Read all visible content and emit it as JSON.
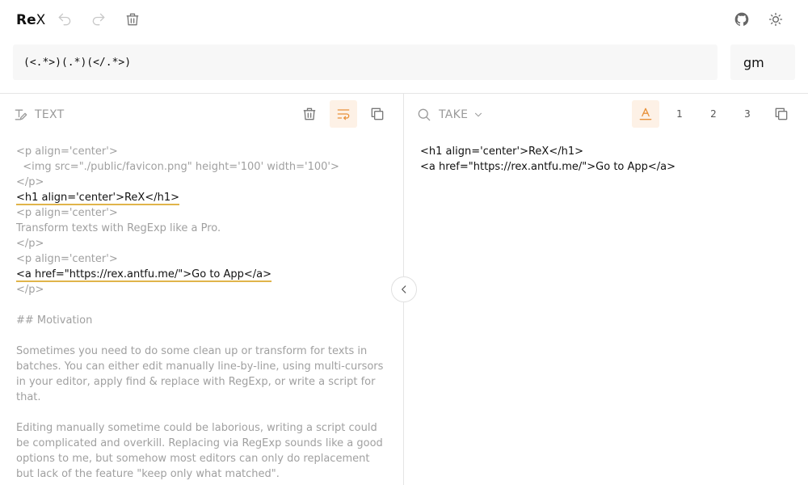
{
  "app": {
    "logo_bold": "Re",
    "logo_light": "X"
  },
  "regex": {
    "pattern": "(<.*>)(.*)(</.*>)",
    "flags": "gm"
  },
  "left_pane": {
    "label": "TEXT",
    "lines": [
      {
        "text": "<p align='center'>",
        "match": false
      },
      {
        "text": "  <img src=\"./public/favicon.png\" height='100' width='100'>",
        "match": false
      },
      {
        "text": "</p>",
        "match": false
      },
      {
        "text": "<h1 align='center'>ReX</h1>",
        "match": true
      },
      {
        "text": "<p align='center'>",
        "match": false
      },
      {
        "text": "Transform texts with RegExp like a Pro.",
        "match": false
      },
      {
        "text": "</p>",
        "match": false
      },
      {
        "text": "<p align='center'>",
        "match": false
      },
      {
        "text": "<a href=\"https://rex.antfu.me/\">Go to App</a>",
        "match": true
      },
      {
        "text": "</p>",
        "match": false
      },
      {
        "text": "",
        "match": false
      },
      {
        "text": "## Motivation",
        "match": false
      },
      {
        "text": "",
        "match": false
      },
      {
        "text": "Sometimes you need to do some clean up or transform for texts in",
        "match": false
      },
      {
        "text": "batches. You can either edit manually line-by-line, using multi-cursors",
        "match": false
      },
      {
        "text": "in your editor, apply find & replace with RegExp, or write a script for",
        "match": false
      },
      {
        "text": "that.",
        "match": false
      },
      {
        "text": "",
        "match": false
      },
      {
        "text": "Editing manually sometime could be laborious, writing a script could",
        "match": false
      },
      {
        "text": "be complicated and overkill. Replacing via RegExp sounds like a good",
        "match": false
      },
      {
        "text": "options to me, but somehow most editors can only do replacement",
        "match": false
      },
      {
        "text": "but lack of the feature \"keep only what matched\".",
        "match": false
      }
    ]
  },
  "right_pane": {
    "label": "TAKE",
    "group_buttons": [
      "1",
      "2",
      "3"
    ],
    "result_lines": [
      "<h1 align='center'>ReX</h1>",
      "<a href=\"https://rex.antfu.me/\">Go to App</a>"
    ]
  },
  "colors": {
    "accent": "#e8913a",
    "match_underline": "#e0b44a",
    "muted_text": "#a0a0a0",
    "icon_gray": "#9a9a9a"
  }
}
